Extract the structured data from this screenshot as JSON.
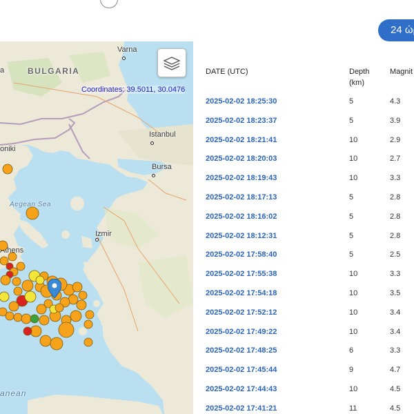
{
  "header": {
    "range_button_label": "24 ώρ"
  },
  "map": {
    "coordinates_text": "Coordinates: 39.5011, 30.0476",
    "labels": {
      "varna": "Varna",
      "bulgaria": "BULGARIA",
      "istanbul": "Istanbul",
      "bursa": "Bursa",
      "thessaloniki": "oniki",
      "aegean_sea": "Aegean Sea",
      "izmir": "Izmir",
      "athens": "Athens",
      "mediterranean": "anean"
    },
    "layers_icon": "layers-icon",
    "marker_icon": "map-pin-icon",
    "colors": {
      "sea": "#b9dff0",
      "land": "#ece9d8",
      "quake_orange": "#f7a21b",
      "quake_yellow": "#f3e63a",
      "quake_red": "#d9231f",
      "quake_green": "#3aa23c",
      "pin": "#3a89d6"
    }
  },
  "table": {
    "headers": {
      "date": "DATE (UTC)",
      "depth": "Depth (km)",
      "magnitude": "Magnit"
    },
    "rows": [
      {
        "date": "2025-02-02 18:25:30",
        "depth": "5",
        "magnitude": "4.3"
      },
      {
        "date": "2025-02-02 18:23:37",
        "depth": "5",
        "magnitude": "3.9"
      },
      {
        "date": "2025-02-02 18:21:41",
        "depth": "10",
        "magnitude": "2.9"
      },
      {
        "date": "2025-02-02 18:20:03",
        "depth": "10",
        "magnitude": "2.7"
      },
      {
        "date": "2025-02-02 18:19:43",
        "depth": "10",
        "magnitude": "3.3"
      },
      {
        "date": "2025-02-02 18:17:13",
        "depth": "5",
        "magnitude": "2.8"
      },
      {
        "date": "2025-02-02 18:16:02",
        "depth": "5",
        "magnitude": "2.8"
      },
      {
        "date": "2025-02-02 18:12:31",
        "depth": "5",
        "magnitude": "2.8"
      },
      {
        "date": "2025-02-02 17:58:40",
        "depth": "5",
        "magnitude": "2.5"
      },
      {
        "date": "2025-02-02 17:55:38",
        "depth": "10",
        "magnitude": "3.3"
      },
      {
        "date": "2025-02-02 17:54:18",
        "depth": "10",
        "magnitude": "3.5"
      },
      {
        "date": "2025-02-02 17:52:12",
        "depth": "10",
        "magnitude": "3.4"
      },
      {
        "date": "2025-02-02 17:49:22",
        "depth": "10",
        "magnitude": "3.4"
      },
      {
        "date": "2025-02-02 17:48:25",
        "depth": "6",
        "magnitude": "3.3"
      },
      {
        "date": "2025-02-02 17:45:44",
        "depth": "9",
        "magnitude": "4.7"
      },
      {
        "date": "2025-02-02 17:44:43",
        "depth": "10",
        "magnitude": "4.5"
      },
      {
        "date": "2025-02-02 17:41:21",
        "depth": "11",
        "magnitude": "4.5"
      }
    ]
  }
}
